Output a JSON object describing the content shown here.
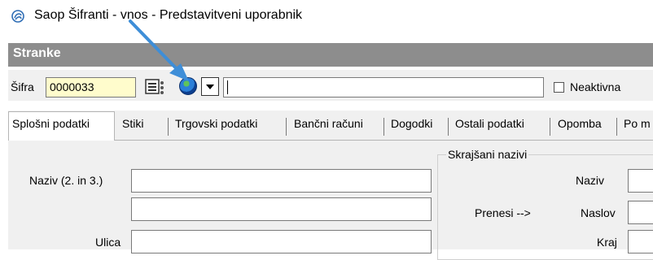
{
  "window": {
    "title": "Saop Šifranti - vnos - Predstavitveni uporabnik"
  },
  "header": {
    "title": "Stranke"
  },
  "toolbar": {
    "sifra_label": "Šifra",
    "sifra_value": "0000033",
    "search_value": "",
    "neaktivna_label": "Neaktivna"
  },
  "tabs": [
    {
      "label": "Splošni podatki"
    },
    {
      "label": "Stiki"
    },
    {
      "label": "Trgovski podatki"
    },
    {
      "label": "Bančni računi"
    },
    {
      "label": "Dogodki"
    },
    {
      "label": "Ostali podatki"
    },
    {
      "label": "Opomba"
    },
    {
      "label": "Po m"
    }
  ],
  "form": {
    "naziv_label": "Naziv (2. in 3.)",
    "ulica_label": "Ulica",
    "group_title": "Skrajšani nazivi",
    "prenesi_label": "Prenesi -->",
    "short_naziv_label": "Naziv",
    "naslov_label": "Naslov",
    "kraj_label": "Kraj"
  }
}
